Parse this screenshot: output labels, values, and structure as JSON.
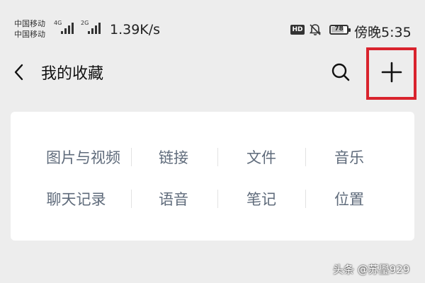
{
  "status_bar": {
    "carrier_1": "中国移动",
    "carrier_2": "中国移动",
    "sim1_network": "4G",
    "sim2_network": "2G",
    "net_speed": "1.39K/s",
    "hd_badge": "HD",
    "battery_level": "78",
    "clock": "傍晚5:35"
  },
  "nav": {
    "title": "我的收藏",
    "back_icon": "chevron-left-icon",
    "search_icon": "search-icon",
    "add_icon": "plus-icon",
    "highlight_color": "#d9232d"
  },
  "categories": {
    "row1": [
      "图片与视频",
      "链接",
      "文件",
      "音乐"
    ],
    "row2": [
      "聊天记录",
      "语音",
      "笔记",
      "位置"
    ]
  },
  "watermark": "头条 @苏璺929"
}
